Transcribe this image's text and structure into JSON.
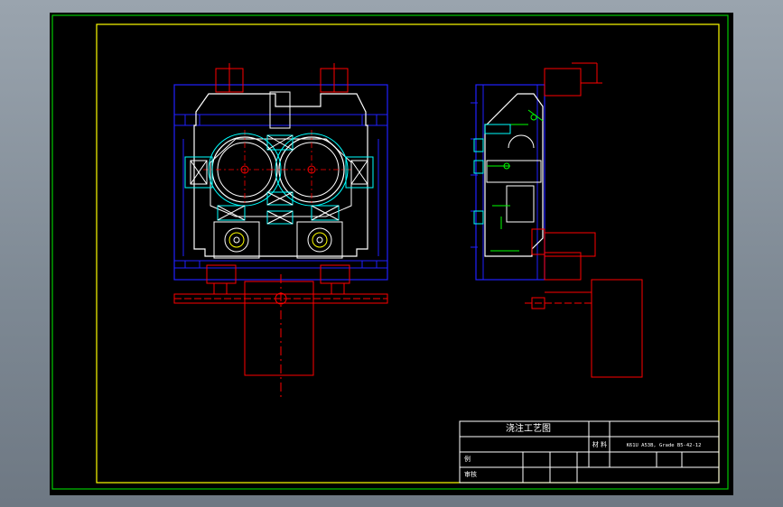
{
  "title_block": {
    "drawing_title": "浇注工艺图",
    "material_label": "材 料",
    "material_value": "K61U A53B, Grade B5-42-12",
    "label_scale": "例",
    "label_check": "审核"
  },
  "colors": {
    "background": "#000000",
    "frame_green": "#00c800",
    "frame_yellow": "#ffff00",
    "outline_blue": "#2020ff",
    "part_white": "#ffffff",
    "core_cyan": "#00ffff",
    "gating_red": "#ff0000",
    "dim_green": "#00ff00"
  }
}
